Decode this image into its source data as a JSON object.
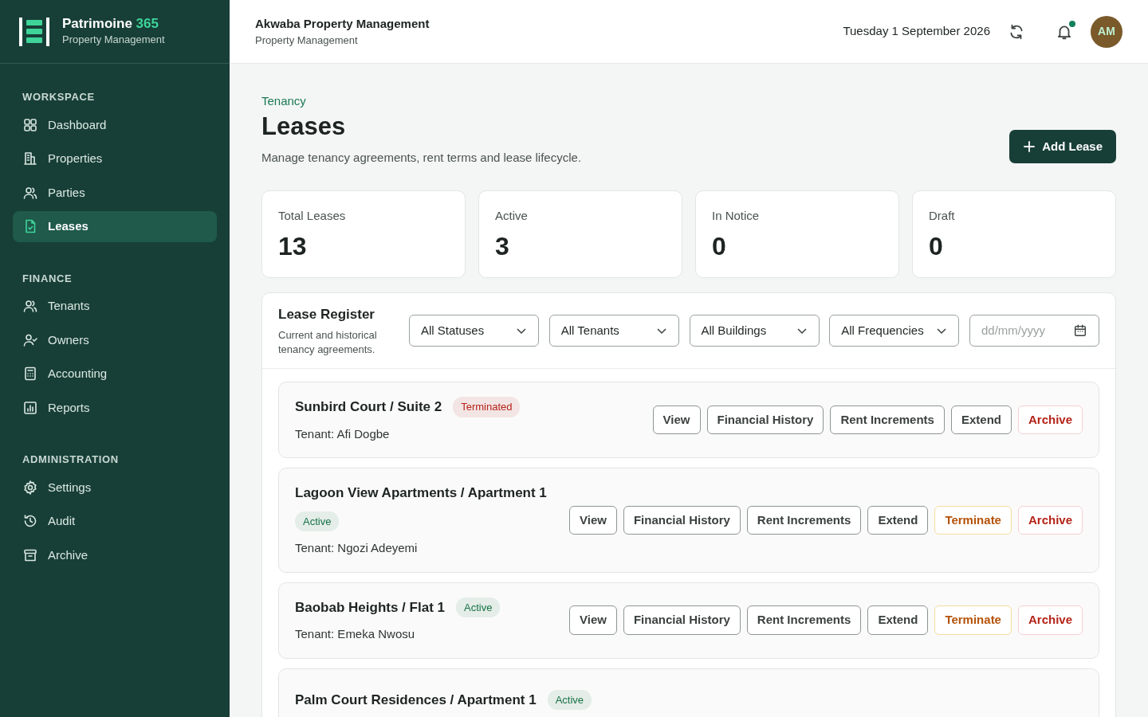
{
  "brand": {
    "name": "Patrimoine",
    "name_accent": "365",
    "subtitle": "Property Management"
  },
  "sidebar": {
    "sections": [
      {
        "heading": "WORKSPACE",
        "items": [
          {
            "label": "Dashboard",
            "selected": false
          },
          {
            "label": "Properties",
            "selected": false
          },
          {
            "label": "Parties",
            "selected": false
          },
          {
            "label": "Leases",
            "selected": true
          }
        ]
      },
      {
        "heading": "FINANCE",
        "items": [
          {
            "label": "Tenants",
            "selected": false
          },
          {
            "label": "Owners",
            "selected": false
          },
          {
            "label": "Accounting",
            "selected": false
          },
          {
            "label": "Reports",
            "selected": false
          }
        ]
      },
      {
        "heading": "ADMINISTRATION",
        "items": [
          {
            "label": "Settings",
            "selected": false
          },
          {
            "label": "Audit",
            "selected": false
          },
          {
            "label": "Archive",
            "selected": false
          }
        ]
      }
    ]
  },
  "header": {
    "org": "Akwaba Property Management",
    "org_subtitle": "Property Management",
    "date": "Tuesday 1 September 2026",
    "notifications_unread": true,
    "avatar": "AM"
  },
  "page": {
    "breadcrumb": "Tenancy",
    "title": "Leases",
    "description": "Manage tenancy agreements, rent terms and lease lifecycle.",
    "primary_action": "Add Lease"
  },
  "stats": [
    {
      "label": "Total Leases",
      "value": "13"
    },
    {
      "label": "Active",
      "value": "3"
    },
    {
      "label": "In Notice",
      "value": "0"
    },
    {
      "label": "Draft",
      "value": "0"
    }
  ],
  "register": {
    "title": "Lease Register",
    "subtitle": "Current and historical tenancy agreements.",
    "filters": [
      {
        "kind": "select",
        "value": "All Statuses"
      },
      {
        "kind": "select",
        "value": "All Tenants"
      },
      {
        "kind": "select",
        "value": "All Buildings"
      },
      {
        "kind": "select",
        "value": "All Frequencies"
      },
      {
        "kind": "date",
        "placeholder": "dd/mm/yyyy"
      }
    ],
    "leases": [
      {
        "title": "Sunbird Court / Suite 2",
        "status": "Terminated",
        "color": "#b42318",
        "tenant": "Tenant: Afi Dogbe",
        "actions": [
          {
            "label": "View",
            "kind": "neutral"
          },
          {
            "label": "Financial History",
            "kind": "neutral"
          },
          {
            "label": "Rent Increments",
            "kind": "neutral"
          },
          {
            "label": "Extend",
            "kind": "neutral"
          },
          {
            "label": "Archive",
            "kind": "danger"
          }
        ]
      },
      {
        "title": "Lagoon View Apartments / Apartment 1",
        "status": "Active",
        "color": "#177245",
        "tenant": "Tenant: Ngozi Adeyemi",
        "actions": [
          {
            "label": "View",
            "kind": "neutral"
          },
          {
            "label": "Financial History",
            "kind": "neutral"
          },
          {
            "label": "Rent Increments",
            "kind": "neutral"
          },
          {
            "label": "Extend",
            "kind": "neutral"
          },
          {
            "label": "Terminate",
            "kind": "warning"
          },
          {
            "label": "Archive",
            "kind": "danger"
          }
        ]
      },
      {
        "title": "Baobab Heights / Flat 1",
        "status": "Active",
        "color": "#177245",
        "tenant": "Tenant: Emeka Nwosu",
        "actions": [
          {
            "label": "View",
            "kind": "neutral"
          },
          {
            "label": "Financial History",
            "kind": "neutral"
          },
          {
            "label": "Rent Increments",
            "kind": "neutral"
          },
          {
            "label": "Extend",
            "kind": "neutral"
          },
          {
            "label": "Terminate",
            "kind": "warning"
          },
          {
            "label": "Archive",
            "kind": "danger"
          }
        ]
      },
      {
        "title": "Palm Court Residences / Apartment 1",
        "status": "Active",
        "color": "#177245"
      }
    ]
  }
}
